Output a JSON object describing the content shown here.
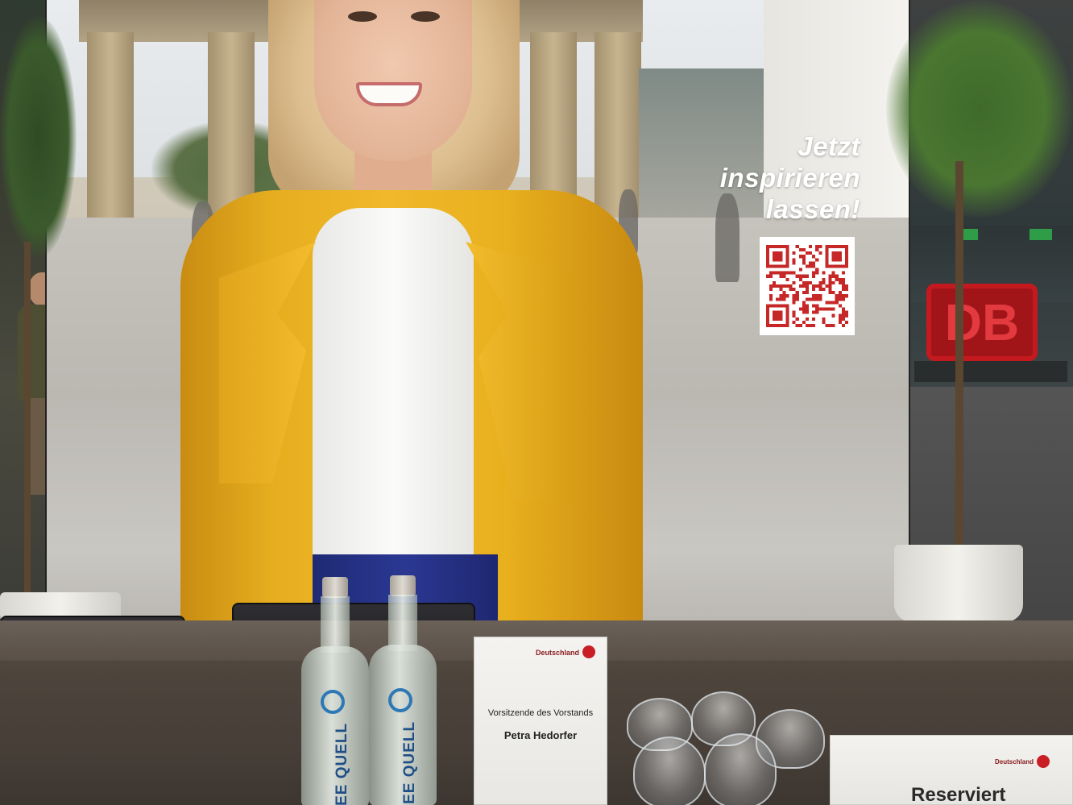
{
  "poster": {
    "cta_line1": "Jetzt",
    "cta_line2": "inspirieren",
    "cta_line3": "lassen!"
  },
  "background": {
    "db_logo_text": "DB"
  },
  "bottles": {
    "brand": "SPREE QUELL"
  },
  "name_card": {
    "brand": "Deutschland",
    "role": "Vorsitzende des Vorstands",
    "name": "Petra Hedorfer"
  },
  "reserved_card": {
    "brand": "Deutschland",
    "text": "Reserviert"
  },
  "colors": {
    "coat_yellow": "#f0b82a",
    "db_red": "#c41a1f",
    "qr_red": "#c62828"
  },
  "icons": [
    "qr-code-icon",
    "db-logo-icon",
    "deutschland-logo-icon"
  ]
}
